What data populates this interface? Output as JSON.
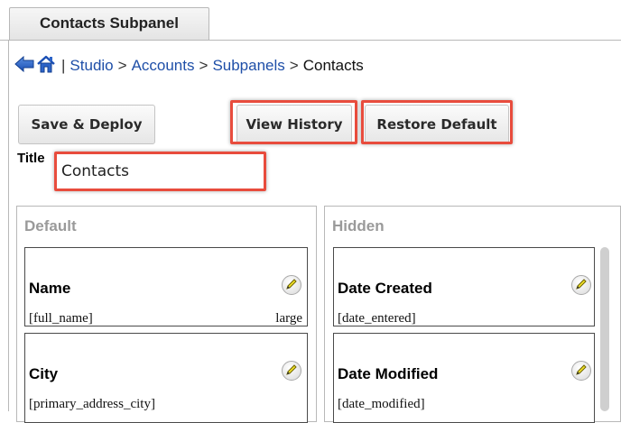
{
  "tab": {
    "label": "Contacts Subpanel"
  },
  "breadcrumb": {
    "separator": ">",
    "pipe": "|",
    "items": [
      "Studio",
      "Accounts",
      "Subpanels",
      "Contacts"
    ]
  },
  "toolbar": {
    "save_deploy": "Save & Deploy",
    "view_history": "View History",
    "restore_default": "Restore Default"
  },
  "title_field": {
    "label": "Title",
    "value": "Contacts"
  },
  "default_column": {
    "header": "Default",
    "fields": [
      {
        "label": "Name",
        "name": "[full_name]",
        "width": "large"
      },
      {
        "label": "City",
        "name": "[primary_address_city]",
        "width": ""
      }
    ]
  },
  "hidden_column": {
    "header": "Hidden",
    "fields": [
      {
        "label": "Date Created",
        "name": "[date_entered]"
      },
      {
        "label": "Date Modified",
        "name": "[date_modified]"
      }
    ]
  },
  "icons": {
    "back": "back-arrow-icon",
    "home": "home-icon",
    "edit": "pencil-icon"
  },
  "colors": {
    "link": "#1f4fa8",
    "highlight": "#e84c3d",
    "column_header": "#9a9a9a"
  }
}
